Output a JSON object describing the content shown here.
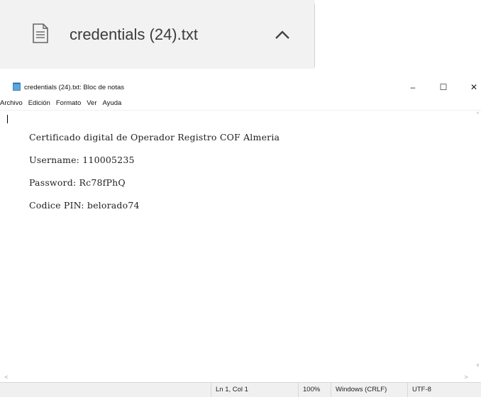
{
  "download_bar": {
    "file_name": "credentials (24).txt",
    "file_icon": "document-icon",
    "expand_icon": "chevron-up-icon"
  },
  "window": {
    "title": "credentials (24).txt: Bloc de notas",
    "app_icon": "notepad-icon",
    "minimize": "–",
    "maximize": "☐",
    "close": "✕"
  },
  "menu": [
    "Archivo",
    "Edición",
    "Formato",
    "Ver",
    "Ayuda"
  ],
  "document": {
    "lines": [
      "Certificado digital de Operador Registro COF Almeria",
      "Username: 110005235",
      "Password: Rc78fPhQ",
      "Codice PIN: belorado74"
    ]
  },
  "status": {
    "position": "Ln 1, Col 1",
    "zoom": "100%",
    "line_ending": "Windows (CRLF)",
    "encoding": "UTF-8"
  },
  "scroll": {
    "up": "^",
    "down": "v",
    "left": "<",
    "right": ">"
  }
}
